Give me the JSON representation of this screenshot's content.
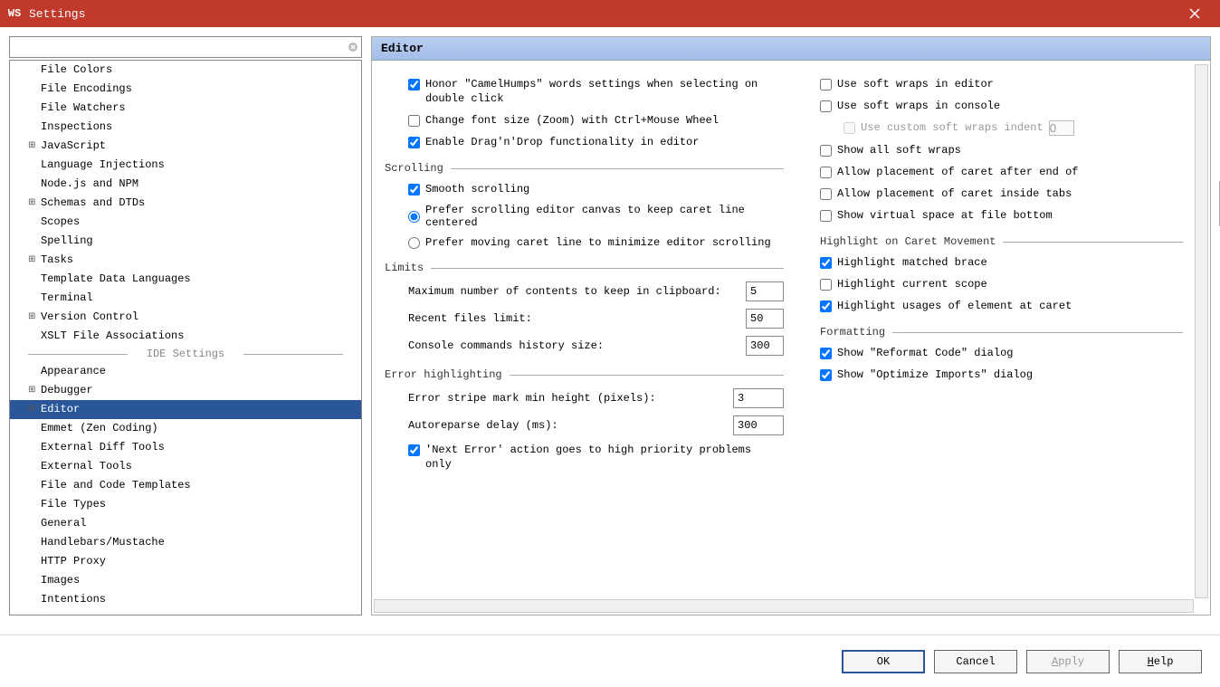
{
  "window": {
    "title": "Settings",
    "icon_label": "WS"
  },
  "search": {
    "value": ""
  },
  "tree": {
    "top_items": [
      {
        "label": "File Colors",
        "exp": false
      },
      {
        "label": "File Encodings",
        "exp": false
      },
      {
        "label": "File Watchers",
        "exp": false
      },
      {
        "label": "Inspections",
        "exp": false
      },
      {
        "label": "JavaScript",
        "exp": true
      },
      {
        "label": "Language Injections",
        "exp": false
      },
      {
        "label": "Node.js and NPM",
        "exp": false
      },
      {
        "label": "Schemas and DTDs",
        "exp": true
      },
      {
        "label": "Scopes",
        "exp": false
      },
      {
        "label": "Spelling",
        "exp": false
      },
      {
        "label": "Tasks",
        "exp": true
      },
      {
        "label": "Template Data Languages",
        "exp": false
      },
      {
        "label": "Terminal",
        "exp": false
      },
      {
        "label": "Version Control",
        "exp": true
      },
      {
        "label": "XSLT File Associations",
        "exp": false
      }
    ],
    "divider": "IDE Settings",
    "ide_items": [
      {
        "label": "Appearance",
        "exp": false
      },
      {
        "label": "Debugger",
        "exp": true
      },
      {
        "label": "Editor",
        "exp": true,
        "selected": true
      },
      {
        "label": "Emmet (Zen Coding)",
        "exp": false
      },
      {
        "label": "External Diff Tools",
        "exp": false
      },
      {
        "label": "External Tools",
        "exp": false
      },
      {
        "label": "File and Code Templates",
        "exp": false
      },
      {
        "label": "File Types",
        "exp": false
      },
      {
        "label": "General",
        "exp": false
      },
      {
        "label": "Handlebars/Mustache",
        "exp": false
      },
      {
        "label": "HTTP Proxy",
        "exp": false
      },
      {
        "label": "Images",
        "exp": false
      },
      {
        "label": "Intentions",
        "exp": false
      }
    ]
  },
  "panel": {
    "title": "Editor",
    "left": {
      "camel_humps": {
        "label": "Honor \"CamelHumps\" words settings when selecting on double click",
        "checked": true
      },
      "change_font": {
        "label": "Change font size (Zoom) with Ctrl+Mouse Wheel",
        "checked": false
      },
      "dragndrop": {
        "label": "Enable Drag'n'Drop functionality in editor",
        "checked": true
      },
      "scrolling": {
        "title": "Scrolling",
        "smooth": {
          "label": "Smooth scrolling",
          "checked": true
        },
        "prefer_canvas": {
          "label": "Prefer scrolling editor canvas to keep caret line centered",
          "selected": true
        },
        "prefer_caret": {
          "label": "Prefer moving caret line to minimize editor scrolling",
          "selected": false
        }
      },
      "limits": {
        "title": "Limits",
        "clipboard": {
          "label": "Maximum number of contents to keep in clipboard:",
          "value": "5"
        },
        "recent": {
          "label": "Recent files limit:",
          "value": "50"
        },
        "console": {
          "label": "Console commands history size:",
          "value": "300"
        }
      },
      "error": {
        "title": "Error highlighting",
        "stripe": {
          "label": "Error stripe mark min height (pixels):",
          "value": "3"
        },
        "autoreparse": {
          "label": "Autoreparse delay (ms):",
          "value": "300"
        },
        "next_error": {
          "label": "'Next Error' action goes to high priority problems only",
          "checked": true
        }
      }
    },
    "right": {
      "soft_wraps_editor": {
        "label": "Use soft wraps in editor",
        "checked": false
      },
      "soft_wraps_console": {
        "label": "Use soft wraps in console",
        "checked": false
      },
      "custom_indent": {
        "label": "Use custom soft wraps indent",
        "checked": false,
        "value": "0"
      },
      "show_all_wraps": {
        "label": "Show all soft wraps",
        "checked": false
      },
      "caret_after_eol": {
        "label": "Allow placement of caret after end of",
        "checked": false
      },
      "caret_inside_tabs": {
        "label": "Allow placement of caret inside tabs",
        "checked": false
      },
      "virtual_space": {
        "label": "Show virtual space at file bottom",
        "checked": false
      },
      "highlight": {
        "title": "Highlight on Caret Movement",
        "brace": {
          "label": "Highlight matched brace",
          "checked": true
        },
        "scope": {
          "label": "Highlight current scope",
          "checked": false
        },
        "usages": {
          "label": "Highlight usages of element at caret",
          "checked": true
        }
      },
      "formatting": {
        "title": "Formatting",
        "reformat": {
          "label": "Show \"Reformat Code\" dialog",
          "checked": true
        },
        "optimize": {
          "label": "Show \"Optimize Imports\" dialog",
          "checked": true
        }
      }
    }
  },
  "footer": {
    "ok": "OK",
    "cancel": "Cancel",
    "apply": "Apply",
    "help": "Help"
  }
}
